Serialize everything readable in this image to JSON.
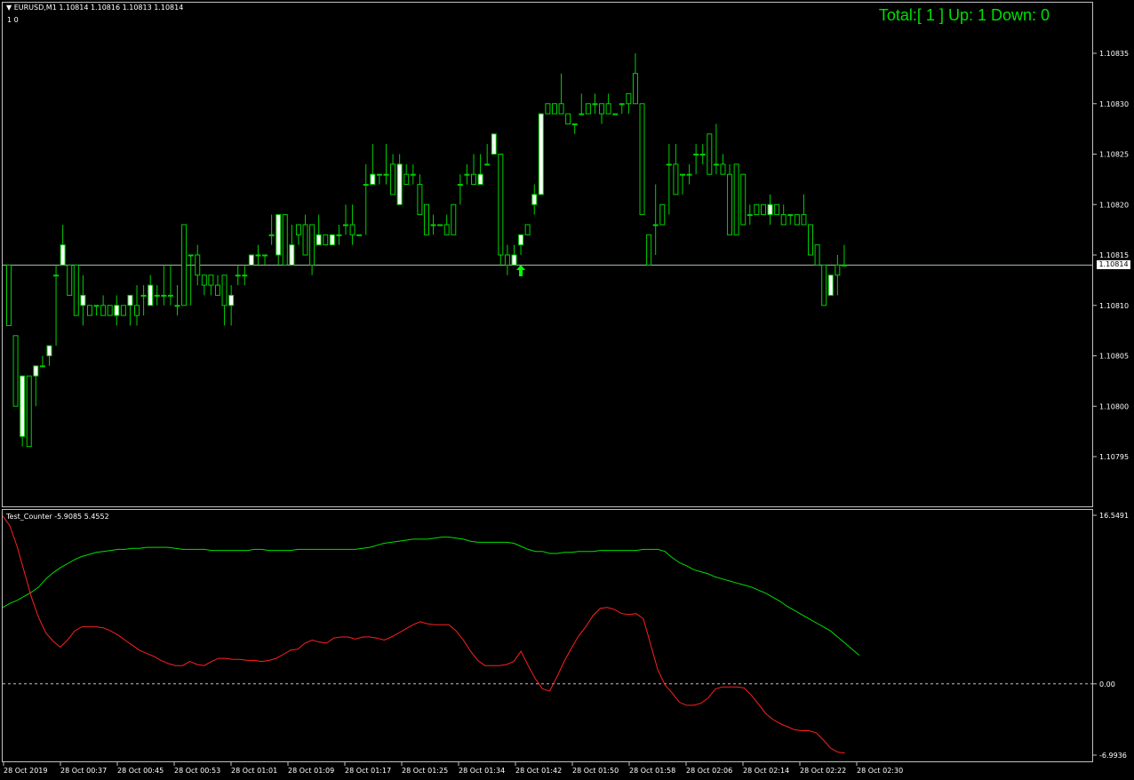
{
  "main": {
    "title": "EURUSD,M1  1.10814 1.10816 1.10813 1.10814",
    "subline": "1    0",
    "total_label": "Total:[ 1 ] Up: 1 Down: 0",
    "current_price": "1.10814",
    "price_labels": [
      "1.10835",
      "1.10830",
      "1.10825",
      "1.10820",
      "1.10815",
      "1.10810",
      "1.10805",
      "1.10800",
      "1.10795"
    ]
  },
  "indicator": {
    "title": "Test_Counter -5.9085 5.4552",
    "labels": [
      "16.5491",
      "0.00",
      "-6.9936"
    ]
  },
  "time_labels": [
    "28 Oct 2019",
    "28 Oct 00:37",
    "28 Oct 00:45",
    "28 Oct 00:53",
    "28 Oct 01:01",
    "28 Oct 01:09",
    "28 Oct 01:17",
    "28 Oct 01:25",
    "28 Oct 01:34",
    "28 Oct 01:42",
    "28 Oct 01:50",
    "28 Oct 01:58",
    "28 Oct 02:06",
    "28 Oct 02:14",
    "28 Oct 02:22",
    "28 Oct 02:30"
  ],
  "colors": {
    "candle_bull": "#ffffff",
    "candle_outline": "#00d000",
    "line_up": "#00e000",
    "line_down": "#ff2020",
    "arrow": "#00ff00"
  },
  "chart_data": {
    "type": "candlestick",
    "ylim": [
      1.1079,
      1.10838
    ],
    "candles": [
      [
        1.10814,
        1.10814,
        1.10808,
        1.10808
      ],
      [
        1.10807,
        1.10807,
        1.108,
        1.108
      ],
      [
        1.10797,
        1.10803,
        1.10796,
        1.10803
      ],
      [
        1.10803,
        1.10803,
        1.10796,
        1.10796
      ],
      [
        1.10803,
        1.10804,
        1.108,
        1.10804
      ],
      [
        1.10804,
        1.10805,
        1.10804,
        1.10804
      ],
      [
        1.10805,
        1.10806,
        1.10804,
        1.10806
      ],
      [
        1.10813,
        1.10814,
        1.10806,
        1.10813
      ],
      [
        1.10814,
        1.10818,
        1.10814,
        1.10816
      ],
      [
        1.10814,
        1.10814,
        1.10811,
        1.10811
      ],
      [
        1.10814,
        1.10814,
        1.10809,
        1.10809
      ],
      [
        1.1081,
        1.10813,
        1.10808,
        1.10811
      ],
      [
        1.1081,
        1.1081,
        1.10809,
        1.10809
      ],
      [
        1.1081,
        1.1081,
        1.10809,
        1.1081
      ],
      [
        1.1081,
        1.10811,
        1.10809,
        1.10809
      ],
      [
        1.1081,
        1.1081,
        1.10809,
        1.10809
      ],
      [
        1.10809,
        1.10811,
        1.10808,
        1.1081
      ],
      [
        1.1081,
        1.1081,
        1.10809,
        1.10809
      ],
      [
        1.1081,
        1.10811,
        1.10808,
        1.10811
      ],
      [
        1.1081,
        1.10812,
        1.10808,
        1.10809
      ],
      [
        1.10811,
        1.10812,
        1.10809,
        1.10811
      ],
      [
        1.1081,
        1.10813,
        1.1081,
        1.10812
      ],
      [
        1.10811,
        1.10812,
        1.1081,
        1.10811
      ],
      [
        1.10811,
        1.10814,
        1.1081,
        1.10811
      ],
      [
        1.10811,
        1.10814,
        1.1081,
        1.10811
      ],
      [
        1.1081,
        1.10812,
        1.10809,
        1.1081
      ],
      [
        1.10818,
        1.10818,
        1.1081,
        1.1081
      ],
      [
        1.10815,
        1.10815,
        1.1081,
        1.10815
      ],
      [
        1.10815,
        1.10816,
        1.10812,
        1.10813
      ],
      [
        1.10813,
        1.10813,
        1.10811,
        1.10812
      ],
      [
        1.10813,
        1.10813,
        1.10811,
        1.10812
      ],
      [
        1.10812,
        1.10813,
        1.10811,
        1.10811
      ],
      [
        1.10813,
        1.10813,
        1.10808,
        1.1081
      ],
      [
        1.1081,
        1.10812,
        1.10808,
        1.10811
      ],
      [
        1.10813,
        1.10814,
        1.10812,
        1.10813
      ],
      [
        1.10813,
        1.10814,
        1.10812,
        1.10813
      ],
      [
        1.10814,
        1.10815,
        1.10814,
        1.10815
      ],
      [
        1.10815,
        1.10816,
        1.10814,
        1.10815
      ],
      [
        1.10815,
        1.10815,
        1.10814,
        1.10815
      ],
      [
        1.10817,
        1.10819,
        1.10816,
        1.10817
      ],
      [
        1.10815,
        1.10819,
        1.10814,
        1.10819
      ],
      [
        1.10819,
        1.10819,
        1.10814,
        1.10814
      ],
      [
        1.10814,
        1.10818,
        1.10814,
        1.10816
      ],
      [
        1.10818,
        1.10818,
        1.10816,
        1.10817
      ],
      [
        1.10818,
        1.10819,
        1.10815,
        1.10815
      ],
      [
        1.10818,
        1.10818,
        1.10813,
        1.10814
      ],
      [
        1.10816,
        1.10819,
        1.10816,
        1.10817
      ],
      [
        1.10817,
        1.10817,
        1.10816,
        1.10816
      ],
      [
        1.10816,
        1.10817,
        1.10816,
        1.10817
      ],
      [
        1.10817,
        1.10818,
        1.10816,
        1.10817
      ],
      [
        1.10818,
        1.1082,
        1.10817,
        1.10818
      ],
      [
        1.10818,
        1.1082,
        1.10816,
        1.10817
      ],
      [
        1.10817,
        1.10817,
        1.10817,
        1.10817
      ],
      [
        1.10822,
        1.10824,
        1.10817,
        1.10822
      ],
      [
        1.10822,
        1.10826,
        1.10822,
        1.10823
      ],
      [
        1.10823,
        1.10823,
        1.10822,
        1.10823
      ],
      [
        1.10823,
        1.10826,
        1.10822,
        1.10823
      ],
      [
        1.10824,
        1.10825,
        1.10821,
        1.10821
      ],
      [
        1.1082,
        1.10825,
        1.1082,
        1.10824
      ],
      [
        1.10823,
        1.10824,
        1.10822,
        1.10822
      ],
      [
        1.10823,
        1.10824,
        1.10822,
        1.10823
      ],
      [
        1.10822,
        1.10823,
        1.10819,
        1.10819
      ],
      [
        1.1082,
        1.1082,
        1.10817,
        1.10817
      ],
      [
        1.10818,
        1.10819,
        1.10817,
        1.10818
      ],
      [
        1.10818,
        1.10818,
        1.10818,
        1.10818
      ],
      [
        1.10818,
        1.10819,
        1.10817,
        1.10817
      ],
      [
        1.1082,
        1.1082,
        1.10817,
        1.10817
      ],
      [
        1.10822,
        1.10823,
        1.1082,
        1.10822
      ],
      [
        1.10823,
        1.10824,
        1.10822,
        1.10823
      ],
      [
        1.10823,
        1.10825,
        1.10822,
        1.10822
      ],
      [
        1.10822,
        1.10825,
        1.10822,
        1.10823
      ],
      [
        1.10824,
        1.10826,
        1.10824,
        1.10824
      ],
      [
        1.10825,
        1.10827,
        1.10825,
        1.10827
      ],
      [
        1.10825,
        1.10825,
        1.10814,
        1.10815
      ],
      [
        1.10815,
        1.10816,
        1.10813,
        1.10814
      ],
      [
        1.10814,
        1.10816,
        1.10814,
        1.10815
      ],
      [
        1.10816,
        1.10817,
        1.10815,
        1.10817
      ],
      [
        1.10818,
        1.10818,
        1.10817,
        1.10817
      ],
      [
        1.1082,
        1.10822,
        1.10819,
        1.10821
      ],
      [
        1.10821,
        1.10829,
        1.10821,
        1.10829
      ],
      [
        1.1083,
        1.1083,
        1.10829,
        1.10829
      ],
      [
        1.1083,
        1.1083,
        1.10829,
        1.10829
      ],
      [
        1.1083,
        1.10833,
        1.10829,
        1.10829
      ],
      [
        1.10829,
        1.10829,
        1.10828,
        1.10828
      ],
      [
        1.10828,
        1.10828,
        1.10827,
        1.10828
      ],
      [
        1.10829,
        1.10831,
        1.10829,
        1.10829
      ],
      [
        1.1083,
        1.1083,
        1.10829,
        1.10829
      ],
      [
        1.1083,
        1.10831,
        1.10829,
        1.1083
      ],
      [
        1.1083,
        1.1083,
        1.10828,
        1.10829
      ],
      [
        1.1083,
        1.10831,
        1.10829,
        1.10829
      ],
      [
        1.10829,
        1.10829,
        1.10829,
        1.10829
      ],
      [
        1.1083,
        1.1083,
        1.10829,
        1.1083
      ],
      [
        1.10831,
        1.10831,
        1.10829,
        1.1083
      ],
      [
        1.10833,
        1.10835,
        1.1083,
        1.1083
      ],
      [
        1.1083,
        1.1083,
        1.10819,
        1.10819
      ],
      [
        1.10817,
        1.10817,
        1.10814,
        1.10814
      ],
      [
        1.10818,
        1.10822,
        1.10815,
        1.10818
      ],
      [
        1.1082,
        1.1082,
        1.10818,
        1.10818
      ],
      [
        1.10824,
        1.10826,
        1.10819,
        1.10824
      ],
      [
        1.10824,
        1.10826,
        1.10821,
        1.10821
      ],
      [
        1.10823,
        1.10823,
        1.10821,
        1.10823
      ],
      [
        1.10823,
        1.10824,
        1.10822,
        1.10823
      ],
      [
        1.10825,
        1.10826,
        1.10823,
        1.10825
      ],
      [
        1.10825,
        1.10826,
        1.10824,
        1.10825
      ],
      [
        1.10827,
        1.10827,
        1.10823,
        1.10823
      ],
      [
        1.10824,
        1.10828,
        1.10823,
        1.10824
      ],
      [
        1.10824,
        1.10825,
        1.10823,
        1.10823
      ],
      [
        1.10823,
        1.10824,
        1.10817,
        1.10817
      ],
      [
        1.10824,
        1.10824,
        1.10817,
        1.10817
      ],
      [
        1.10823,
        1.10823,
        1.10818,
        1.10818
      ],
      [
        1.10819,
        1.1082,
        1.10818,
        1.10819
      ],
      [
        1.1082,
        1.1082,
        1.10819,
        1.10819
      ],
      [
        1.1082,
        1.1082,
        1.10819,
        1.10819
      ],
      [
        1.10819,
        1.10821,
        1.10818,
        1.1082
      ],
      [
        1.1082,
        1.1082,
        1.10819,
        1.10819
      ],
      [
        1.10819,
        1.1082,
        1.10818,
        1.10818
      ],
      [
        1.10819,
        1.10819,
        1.10818,
        1.10819
      ],
      [
        1.10819,
        1.10819,
        1.10818,
        1.10818
      ],
      [
        1.10819,
        1.10821,
        1.10818,
        1.10818
      ],
      [
        1.10818,
        1.10818,
        1.10815,
        1.10815
      ],
      [
        1.10816,
        1.10816,
        1.10814,
        1.10814
      ],
      [
        1.10814,
        1.10814,
        1.1081,
        1.1081
      ],
      [
        1.10811,
        1.10813,
        1.10811,
        1.10813
      ],
      [
        1.10814,
        1.10815,
        1.10811,
        1.10813
      ],
      [
        1.10814,
        1.10816,
        1.10814,
        1.10814
      ]
    ],
    "arrow_index": 76,
    "indicator_ylim": [
      -6.9936,
      16.5491
    ],
    "green": [
      7.5,
      7.9,
      8.2,
      8.6,
      9.0,
      9.5,
      10.3,
      10.9,
      11.4,
      11.8,
      12.2,
      12.5,
      12.7,
      12.9,
      13.0,
      13.1,
      13.2,
      13.2,
      13.3,
      13.3,
      13.4,
      13.4,
      13.4,
      13.4,
      13.3,
      13.2,
      13.2,
      13.2,
      13.2,
      13.1,
      13.1,
      13.1,
      13.1,
      13.1,
      13.1,
      13.2,
      13.2,
      13.1,
      13.1,
      13.1,
      13.1,
      13.2,
      13.2,
      13.2,
      13.2,
      13.2,
      13.2,
      13.2,
      13.2,
      13.2,
      13.3,
      13.4,
      13.6,
      13.8,
      13.9,
      14.0,
      14.1,
      14.2,
      14.2,
      14.2,
      14.3,
      14.4,
      14.4,
      14.3,
      14.2,
      14.0,
      13.9,
      13.9,
      13.9,
      13.9,
      13.9,
      13.8,
      13.5,
      13.2,
      13.0,
      13.0,
      12.8,
      12.8,
      12.9,
      12.9,
      13.0,
      13.0,
      13.0,
      13.1,
      13.1,
      13.1,
      13.1,
      13.1,
      13.1,
      13.2,
      13.2,
      13.2,
      13.0,
      12.4,
      11.9,
      11.6,
      11.2,
      11.0,
      10.8,
      10.5,
      10.3,
      10.1,
      9.9,
      9.7,
      9.5,
      9.2,
      8.9,
      8.5,
      8.1,
      7.6,
      7.2,
      6.8,
      6.4,
      6.0,
      5.6,
      5.2,
      4.6,
      4.0,
      3.4,
      2.8
    ],
    "red": [
      16.5,
      15.5,
      13.5,
      11.0,
      8.5,
      6.5,
      5.0,
      4.2,
      3.6,
      4.3,
      5.2,
      5.6,
      5.6,
      5.6,
      5.5,
      5.2,
      4.8,
      4.3,
      3.8,
      3.3,
      3.0,
      2.7,
      2.3,
      2.0,
      1.8,
      1.8,
      2.2,
      1.9,
      1.8,
      2.2,
      2.5,
      2.5,
      2.4,
      2.4,
      2.3,
      2.3,
      2.2,
      2.3,
      2.5,
      2.9,
      3.3,
      3.4,
      4.0,
      4.3,
      4.1,
      4.0,
      4.5,
      4.6,
      4.6,
      4.4,
      4.6,
      4.6,
      4.5,
      4.3,
      4.6,
      5.0,
      5.4,
      5.8,
      6.1,
      5.9,
      5.8,
      5.8,
      5.8,
      5.2,
      4.3,
      3.2,
      2.3,
      1.8,
      1.8,
      1.8,
      1.9,
      2.2,
      3.2,
      1.8,
      0.5,
      -0.5,
      -0.7,
      0.7,
      2.2,
      3.5,
      4.7,
      5.6,
      6.7,
      7.4,
      7.5,
      7.3,
      6.9,
      6.8,
      6.9,
      6.4,
      3.9,
      1.4,
      -0.1,
      -0.9,
      -1.8,
      -2.1,
      -2.1,
      -1.9,
      -1.4,
      -0.5,
      -0.3,
      -0.3,
      -0.3,
      -0.4,
      -1.1,
      -2.0,
      -2.9,
      -3.5,
      -3.9,
      -4.2,
      -4.5,
      -4.6,
      -4.6,
      -4.8,
      -5.5,
      -6.3,
      -6.7,
      -6.8
    ]
  }
}
